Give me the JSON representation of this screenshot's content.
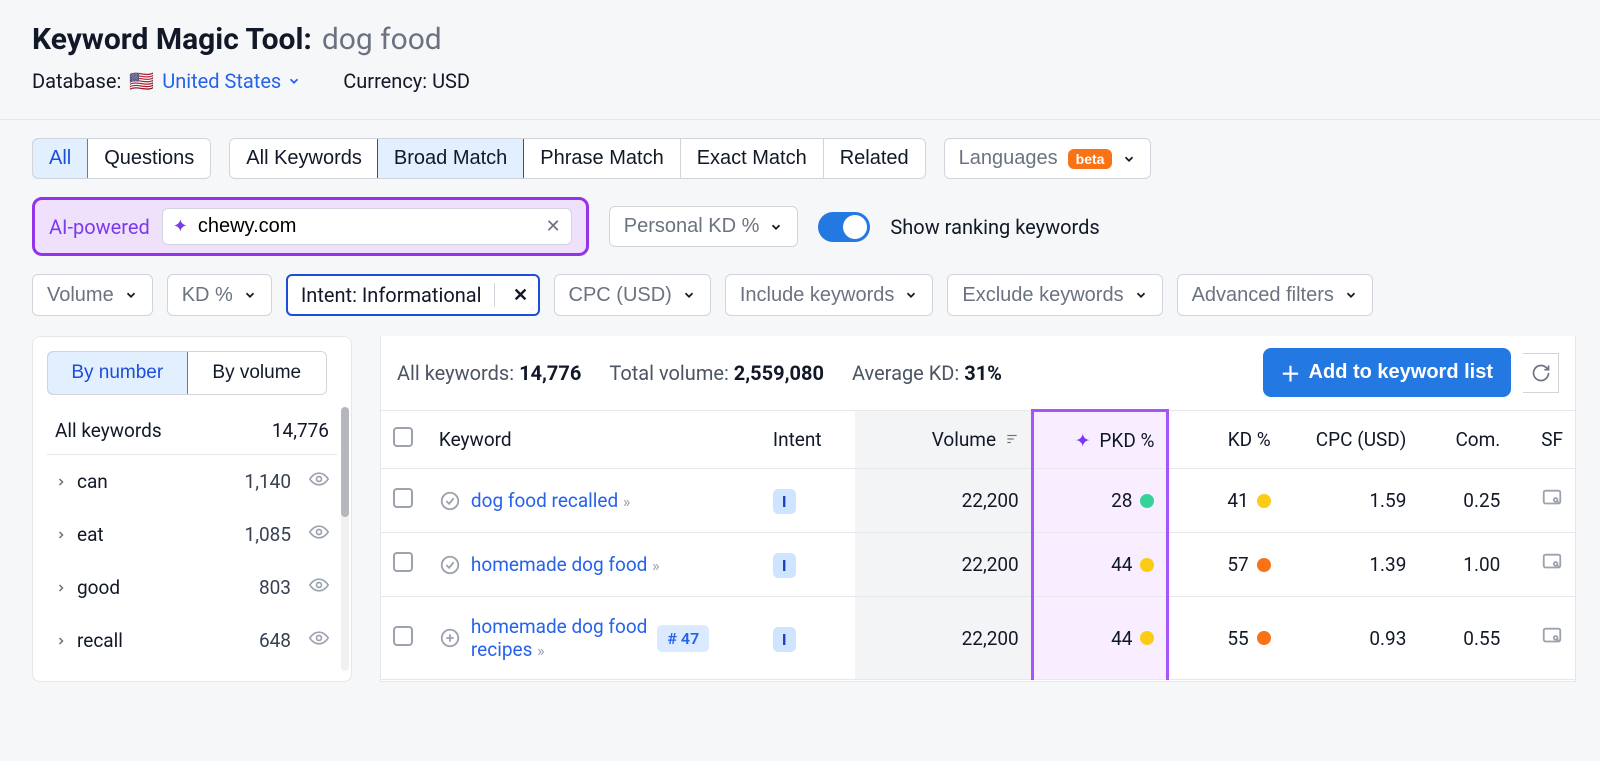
{
  "header": {
    "title": "Keyword Magic Tool:",
    "query": "dog food",
    "database_label": "Database:",
    "country": "United States",
    "currency_label": "Currency:",
    "currency": "USD"
  },
  "tab_groups": {
    "g1": [
      "All",
      "Questions"
    ],
    "g2": [
      "All Keywords",
      "Broad Match",
      "Phrase Match",
      "Exact Match",
      "Related"
    ],
    "g1_active": 0,
    "g2_active": 1,
    "languages_label": "Languages",
    "beta": "beta"
  },
  "ai": {
    "label": "AI-powered",
    "domain": "chewy.com",
    "personal_kd_label": "Personal KD %",
    "toggle_label": "Show ranking keywords"
  },
  "filters": {
    "volume": "Volume",
    "kd": "KD %",
    "intent": "Intent: Informational",
    "cpc": "CPC (USD)",
    "include": "Include keywords",
    "exclude": "Exclude keywords",
    "advanced": "Advanced filters"
  },
  "sidebar": {
    "seg": [
      "By number",
      "By volume"
    ],
    "seg_active": 0,
    "all_label": "All keywords",
    "all_count": "14,776",
    "items": [
      {
        "label": "can",
        "count": "1,140"
      },
      {
        "label": "eat",
        "count": "1,085"
      },
      {
        "label": "good",
        "count": "803"
      },
      {
        "label": "recall",
        "count": "648"
      }
    ]
  },
  "stats": {
    "all_kw_label": "All keywords:",
    "all_kw": "14,776",
    "total_vol_label": "Total volume:",
    "total_vol": "2,559,080",
    "avg_kd_label": "Average KD:",
    "avg_kd": "31%",
    "add_btn": "Add to keyword list"
  },
  "columns": {
    "keyword": "Keyword",
    "intent": "Intent",
    "volume": "Volume",
    "pkd": "PKD %",
    "kd": "KD %",
    "cpc": "CPC (USD)",
    "com": "Com.",
    "sf": "SF"
  },
  "rows": [
    {
      "keyword": "dog food recalled",
      "has_check": true,
      "rank_badge": "",
      "intent": "I",
      "volume": "22,200",
      "pkd": "28",
      "pkd_dot": "d-green",
      "kd": "41",
      "kd_dot": "d-yellow",
      "cpc": "1.59",
      "com": "0.25"
    },
    {
      "keyword": "homemade dog food",
      "has_check": true,
      "rank_badge": "",
      "intent": "I",
      "volume": "22,200",
      "pkd": "44",
      "pkd_dot": "d-yellow",
      "kd": "57",
      "kd_dot": "d-orange",
      "cpc": "1.39",
      "com": "1.00"
    },
    {
      "keyword": "homemade dog food recipes",
      "has_check": false,
      "rank_badge": "# 47",
      "intent": "I",
      "volume": "22,200",
      "pkd": "44",
      "pkd_dot": "d-yellow",
      "kd": "55",
      "kd_dot": "d-orange",
      "cpc": "0.93",
      "com": "0.55"
    }
  ]
}
